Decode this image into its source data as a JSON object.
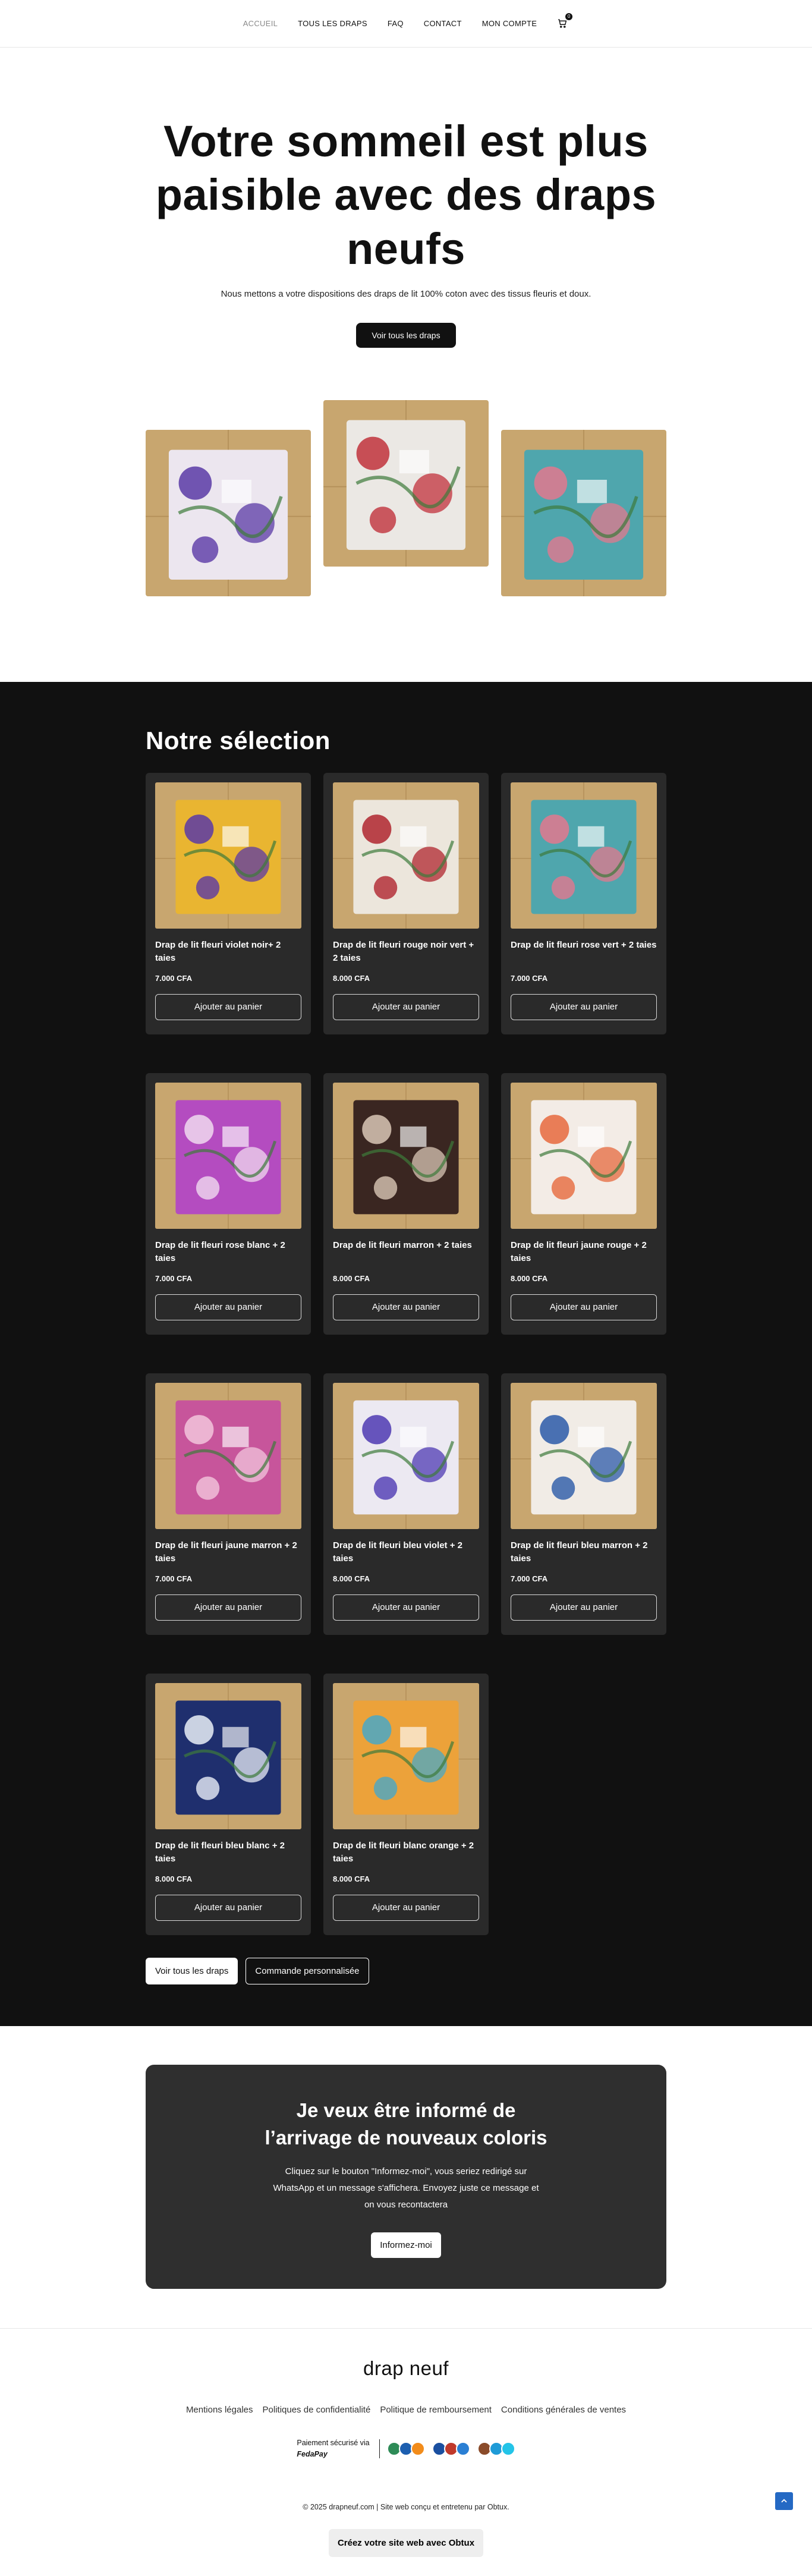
{
  "nav": {
    "items": [
      "ACCUEIL",
      "TOUS LES DRAPS",
      "FAQ",
      "CONTACT",
      "MON COMPTE"
    ],
    "cart_count": "0"
  },
  "hero": {
    "title": "Votre sommeil est plus paisible avec des draps neufs",
    "subtitle": "Nous mettons a votre dispositions des draps de lit 100% coton avec des tissus fleuris et doux.",
    "button": "Voir tous les draps"
  },
  "selection": {
    "title": "Notre sélection",
    "add_label": "Ajouter au panier",
    "products": [
      {
        "name": "Drap de lit fleuri violet noir+ 2 taies",
        "price": "7.000 CFA",
        "base": "#e9b531",
        "accent": "#5b3aa6"
      },
      {
        "name": "Drap de lit fleuri rouge noir vert + 2 taies",
        "price": "8.000 CFA",
        "base": "#ece6dc",
        "accent": "#b0262f"
      },
      {
        "name": "Drap de lit fleuri rose vert + 2 taies",
        "price": "7.000 CFA",
        "base": "#4fa6ad",
        "accent": "#e2788e"
      },
      {
        "name": "Drap de lit fleuri rose blanc + 2 taies",
        "price": "7.000 CFA",
        "base": "#b44cc0",
        "accent": "#f0d9ef"
      },
      {
        "name": "Drap de lit fleuri marron + 2 taies",
        "price": "8.000 CFA",
        "base": "#3a2621",
        "accent": "#d9c7b5"
      },
      {
        "name": "Drap de lit fleuri jaune rouge + 2 taies",
        "price": "8.000 CFA",
        "base": "#f3ece6",
        "accent": "#e66a3d"
      },
      {
        "name": "Drap de lit fleuri jaune marron + 2 taies",
        "price": "7.000 CFA",
        "base": "#c7559b",
        "accent": "#f2c6dc"
      },
      {
        "name": "Drap de lit fleuri bleu violet + 2 taies",
        "price": "8.000 CFA",
        "base": "#ece9f2",
        "accent": "#4f3ab3"
      },
      {
        "name": "Drap de lit fleuri bleu marron + 2 taies",
        "price": "7.000 CFA",
        "base": "#f1ece6",
        "accent": "#2b5aa8"
      },
      {
        "name": "Drap de lit fleuri bleu blanc + 2 taies",
        "price": "8.000 CFA",
        "base": "#1f2f6e",
        "accent": "#e9eef7"
      },
      {
        "name": "Drap de lit fleuri blanc orange + 2 taies",
        "price": "8.000 CFA",
        "base": "#eca23a",
        "accent": "#4aa8c7"
      }
    ],
    "btn_all": "Voir tous les draps",
    "btn_custom": "Commande personnalisée"
  },
  "notify": {
    "title_line1": "Je veux être informé de",
    "title_line2": "l’arrivage de nouveaux coloris",
    "text": "Cliquez sur le bouton \"Informez-moi\", vous seriez redirigé sur WhatsApp et un message s'affichera. Envoyez juste ce message et on vous recontactera",
    "button": "Informez-moi"
  },
  "footer": {
    "brand": "drap neuf",
    "links": [
      "Mentions légales",
      "Politiques de confidentialité",
      "Politique de remboursement",
      "Conditions générales de ventes"
    ],
    "pay_text": "Paiement sécurisé via",
    "pay_brand": "FedaPay",
    "copyright": "© 2025 drapneuf.com | Site web conçu et entretenu par Obtux.",
    "made_with": "Créez votre site web avec Obtux"
  },
  "colors": {
    "dark": "#111111",
    "card": "#2a2a2a",
    "notify_bg": "#2f2f2f",
    "scroll_top": "#2469c4",
    "wood": "#c8a66f"
  },
  "hero_images": [
    {
      "base": "#ece6ef",
      "accent": "#5b3aa6"
    },
    {
      "base": "#ebe8e4",
      "accent": "#c1323c"
    },
    {
      "base": "#4fa6ad",
      "accent": "#e2788e"
    }
  ]
}
